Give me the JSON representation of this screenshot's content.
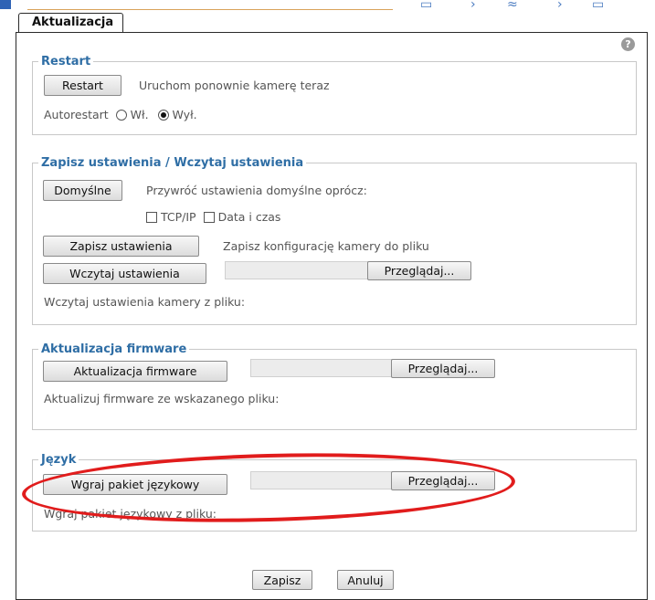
{
  "tab": {
    "label": "Aktualizacja"
  },
  "restart": {
    "legend": "Restart",
    "button": "Restart",
    "description": "Uruchom ponownie kamerę teraz",
    "autorestart_label": "Autorestart",
    "option_on": "Wł.",
    "option_off": "Wył.",
    "selected": "Wył."
  },
  "settings": {
    "legend": "Zapisz ustawienia / Wczytaj ustawienia",
    "defaults_button": "Domyślne",
    "defaults_desc": "Przywróć ustawienia domyślne oprócz:",
    "tcpip_label": "TCP/IP",
    "datetime_label": "Data i czas",
    "save_button": "Zapisz ustawienia",
    "save_desc": "Zapisz konfigurację kamery do pliku",
    "load_button": "Wczytaj ustawienia",
    "browse_button": "Przeglądaj...",
    "load_desc": "Wczytaj ustawienia kamery z pliku:"
  },
  "firmware": {
    "legend": "Aktualizacja firmware",
    "button": "Aktualizacja firmware",
    "browse_button": "Przeglądaj...",
    "desc": "Aktualizuj firmware ze wskazanego pliku:"
  },
  "language": {
    "legend": "Język",
    "button": "Wgraj pakiet językowy",
    "browse_button": "Przeglądaj...",
    "desc": "Wgraj pakiet językowy z pliku:"
  },
  "footer": {
    "save": "Zapisz",
    "cancel": "Anuluj"
  },
  "colors": {
    "legend": "#2f6ea5",
    "annotation": "#e11c1c",
    "text": "#555555"
  }
}
